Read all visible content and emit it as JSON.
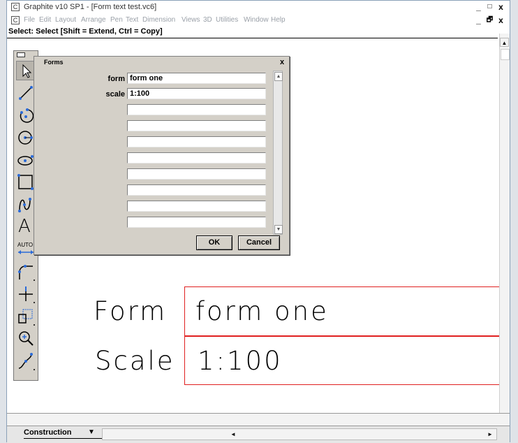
{
  "window": {
    "title": "Graphite v10 SP1 - [Form text test.vc6]"
  },
  "titlebar_buttons": {
    "minimize": "_",
    "maximize": "□",
    "close": "x"
  },
  "menu": [
    "File",
    "Edit",
    "Layout",
    "Arrange",
    "Pen",
    "Text",
    "Dimension",
    "Views",
    "3D",
    "Utilities",
    "Window",
    "Help"
  ],
  "doc_buttons": {
    "minimize": "_",
    "restore": "🗗",
    "close": "x"
  },
  "status": "Select: Select  [Shift = Extend, Ctrl = Copy]",
  "tools": [
    "select-arrow",
    "line",
    "arc",
    "circle",
    "ellipse",
    "rectangle",
    "spline",
    "text",
    "auto-dimension",
    "fillet",
    "perpendicular",
    "offset",
    "zoom",
    "bezier"
  ],
  "tool_labels": {
    "text": "A",
    "auto": "AUTO"
  },
  "forms_dialog": {
    "title": "Forms",
    "close": "x",
    "fields": [
      {
        "label": "form",
        "value": "form one"
      },
      {
        "label": "scale",
        "value": "1:100"
      },
      {
        "label": "",
        "value": ""
      },
      {
        "label": "",
        "value": ""
      },
      {
        "label": "",
        "value": ""
      },
      {
        "label": "",
        "value": ""
      },
      {
        "label": "",
        "value": ""
      },
      {
        "label": "",
        "value": ""
      },
      {
        "label": "",
        "value": ""
      },
      {
        "label": "",
        "value": ""
      }
    ],
    "ok": "OK",
    "cancel": "Cancel"
  },
  "drawing": {
    "form_label": "Form",
    "form_value": "form one",
    "scale_label": "Scale",
    "scale_value": "1:100",
    "line_color": "#e02020"
  },
  "layer": {
    "name": "Construction",
    "arrow": "▼"
  },
  "scroll_arrows": {
    "up": "▲",
    "down": "▼",
    "left": "◄",
    "right": "►"
  }
}
